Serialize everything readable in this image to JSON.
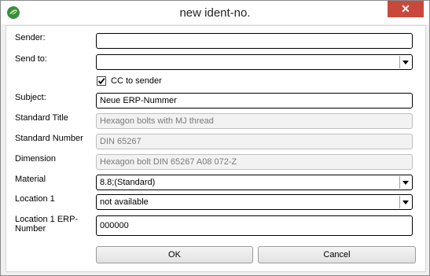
{
  "window": {
    "title": "new ident-no.",
    "close_glyph": "✕",
    "app_icon": "green-leaf-icon",
    "close_color": "#c9483c"
  },
  "form": {
    "sender_label": "Sender:",
    "sender_value": "",
    "sendto_label": "Send to:",
    "sendto_value": "",
    "cc_label": "CC to sender",
    "cc_checked": true,
    "subject_label": "Subject:",
    "subject_value": "Neue ERP-Nummer",
    "standard_title_label": "Standard Title",
    "standard_title_value": "Hexagon bolts with MJ thread",
    "standard_number_label": "Standard Number",
    "standard_number_value": "DIN 65267",
    "dimension_label": "Dimension",
    "dimension_value": "Hexagon bolt DIN 65267 A08 072-Z",
    "material_label": "Material",
    "material_value": "8.8;(Standard)",
    "location1_label": "Location 1",
    "location1_value": "not available",
    "location1_erp_label_line1": "Location 1 ERP-",
    "location1_erp_label_line2": "Number",
    "location1_erp_value": "000000"
  },
  "buttons": {
    "ok": "OK",
    "cancel": "Cancel"
  }
}
